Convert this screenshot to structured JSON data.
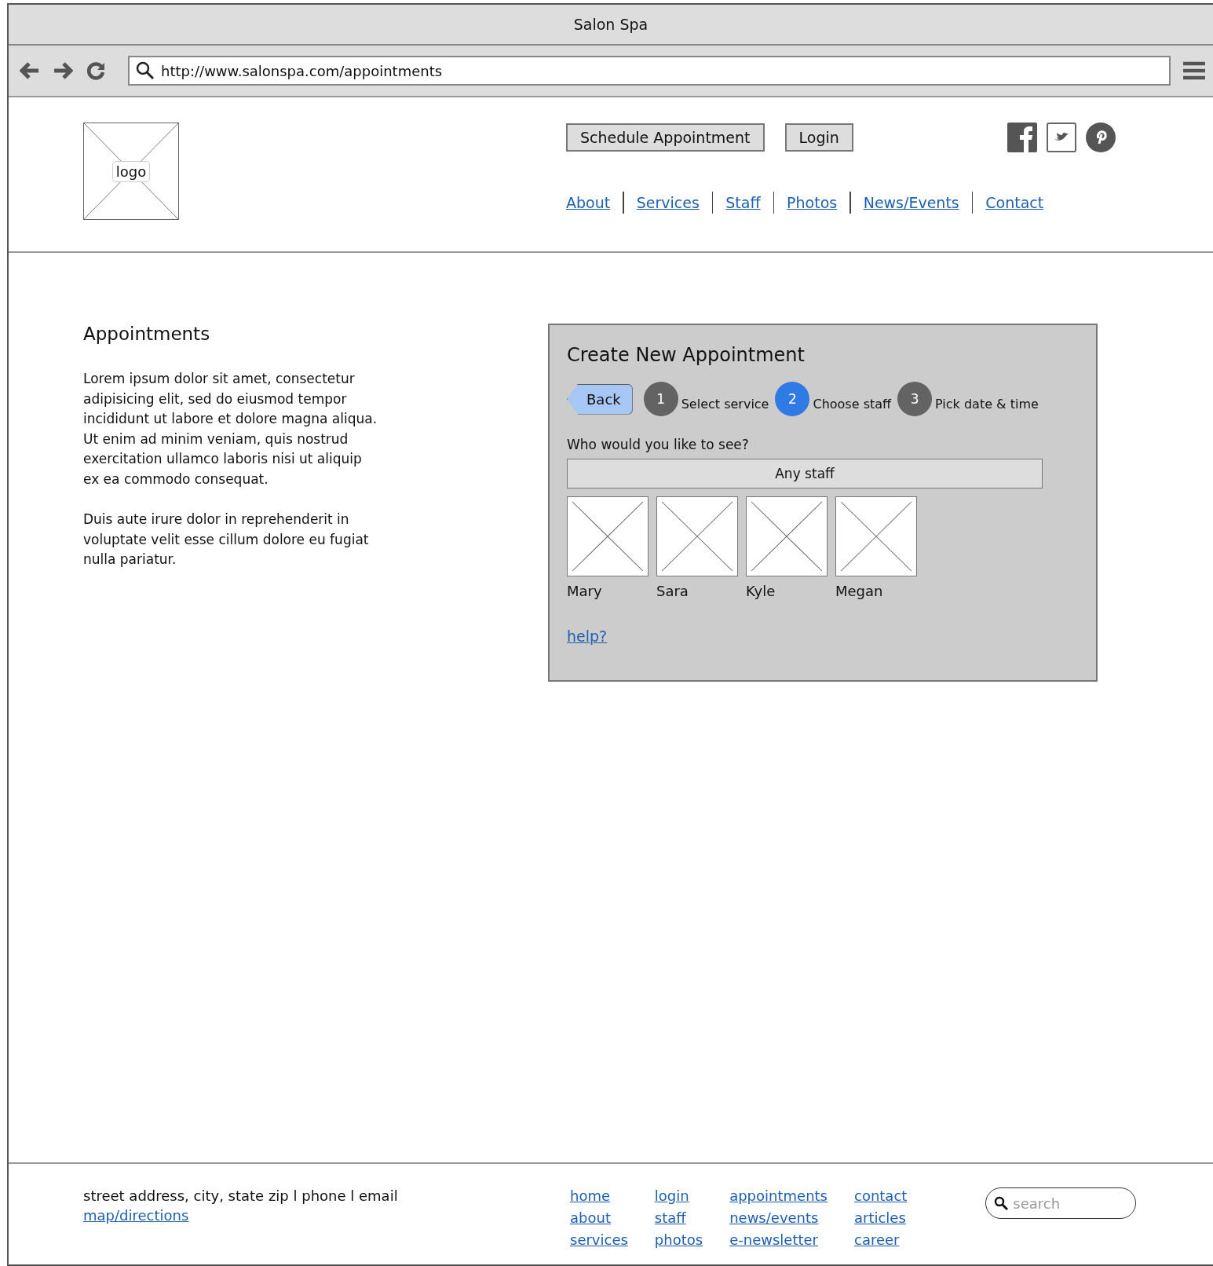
{
  "window": {
    "title": "Salon Spa"
  },
  "address_bar": {
    "value": "http://www.salonspa.com/appointments"
  },
  "header": {
    "logo": "logo",
    "buttons": [
      "Schedule Appointment",
      "Login"
    ],
    "nav": [
      "About",
      "Services",
      "Staff",
      "Photos",
      "News/Events",
      "Contact"
    ]
  },
  "intro": {
    "title": "Appointments",
    "paragraphs": [
      "Lorem ipsum dolor sit amet, consectetur adipisicing elit, sed do eiusmod tempor incididunt ut labore et dolore magna aliqua. Ut enim ad minim veniam, quis nostrud exercitation ullamco laboris nisi ut aliquip ex ea commodo consequat.",
      "Duis aute irure dolor in reprehenderit in voluptate velit esse cillum dolore eu fugiat nulla pariatur."
    ]
  },
  "panel": {
    "title": "Create New Appointment",
    "back": "Back",
    "steps": [
      {
        "number": "1",
        "label": "Select service",
        "selected": false
      },
      {
        "number": "2",
        "label": "Choose staff",
        "selected": true
      },
      {
        "number": "3",
        "label": "Pick date & time",
        "selected": false
      }
    ],
    "question": "Who would you like to see?",
    "any_staff": "Any staff",
    "staff": [
      "Mary",
      "Sara",
      "Kyle",
      "Megan"
    ],
    "help": "help?"
  },
  "footer": {
    "address": "street address, city, state zip l phone l email",
    "map_link": "map/directions",
    "link_columns": [
      [
        "home",
        "about",
        "services"
      ],
      [
        "login",
        "staff",
        "photos"
      ],
      [
        "appointments",
        "news/events",
        "e-newsletter"
      ],
      [
        "contact",
        "articles",
        "career"
      ]
    ],
    "search": {
      "placeholder": "search"
    }
  }
}
